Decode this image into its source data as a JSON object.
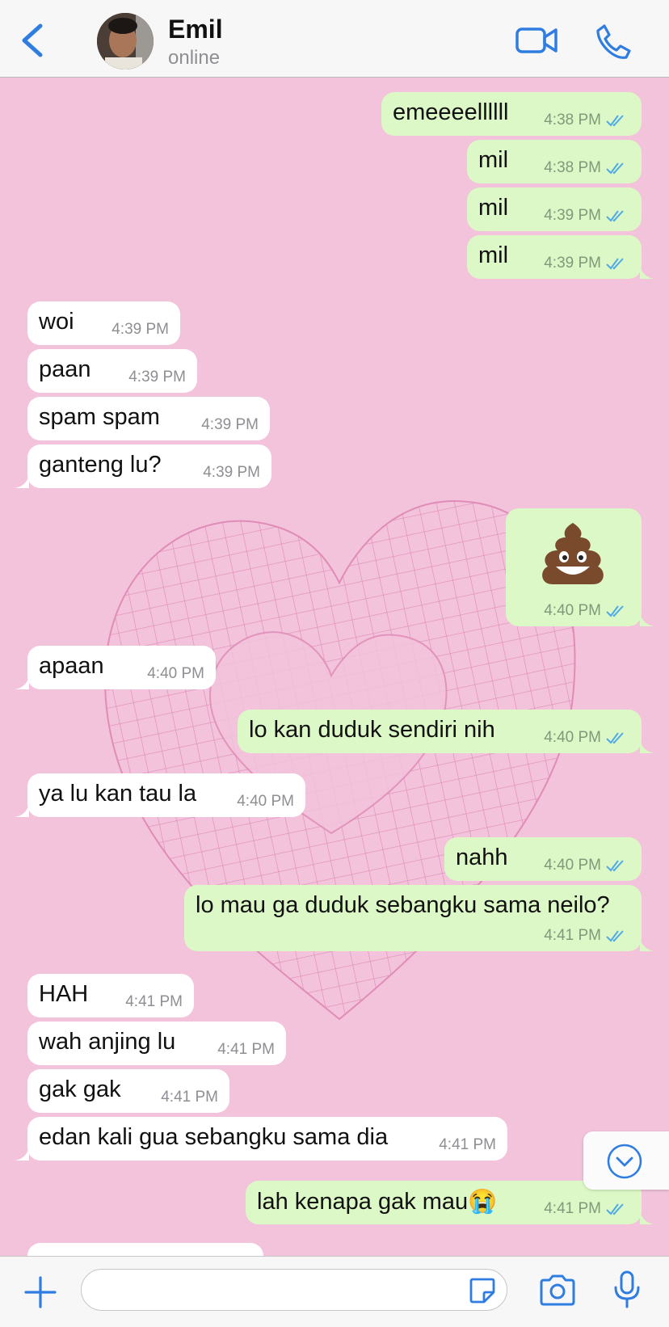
{
  "header": {
    "contact_name": "Emil",
    "status": "online"
  },
  "colors": {
    "accent": "#2f7de1",
    "outgoing_bubble": "#dcf8c6",
    "incoming_bubble": "#ffffff",
    "chat_background": "#f2c3db",
    "read_ticks": "#4fa9e8"
  },
  "messages": [
    {
      "text": "emeeeellllll",
      "time": "4:38 PM",
      "dir": "out",
      "read": true
    },
    {
      "text": "mil",
      "time": "4:38 PM",
      "dir": "out",
      "read": true
    },
    {
      "text": "mil",
      "time": "4:39 PM",
      "dir": "out",
      "read": true
    },
    {
      "text": "mil",
      "time": "4:39 PM",
      "dir": "out",
      "read": true
    },
    {
      "text": "woi",
      "time": "4:39 PM",
      "dir": "in"
    },
    {
      "text": "paan",
      "time": "4:39 PM",
      "dir": "in"
    },
    {
      "text": "spam spam",
      "time": "4:39 PM",
      "dir": "in"
    },
    {
      "text": "ganteng lu?",
      "time": "4:39 PM",
      "dir": "in"
    },
    {
      "text": "",
      "emoji": "poop-emoji",
      "time": "4:40 PM",
      "dir": "out",
      "read": true
    },
    {
      "text": "apaan",
      "time": "4:40 PM",
      "dir": "in"
    },
    {
      "text": "lo kan duduk sendiri nih",
      "time": "4:40 PM",
      "dir": "out",
      "read": true
    },
    {
      "text": "ya lu kan tau la",
      "time": "4:40 PM",
      "dir": "in"
    },
    {
      "text": "nahh",
      "time": "4:40 PM",
      "dir": "out",
      "read": true
    },
    {
      "text": "lo mau ga duduk sebangku sama neilo?",
      "time": "4:41 PM",
      "dir": "out",
      "read": true
    },
    {
      "text": "HAH",
      "time": "4:41 PM",
      "dir": "in"
    },
    {
      "text": "wah anjing lu",
      "time": "4:41 PM",
      "dir": "in"
    },
    {
      "text": "gak gak",
      "time": "4:41 PM",
      "dir": "in"
    },
    {
      "text": "edan kali gua sebangku sama dia",
      "time": "4:41 PM",
      "dir": "in"
    },
    {
      "text": "lah kenapa gak mau😭",
      "time": "4:41 PM",
      "dir": "out",
      "read": true
    }
  ],
  "composer": {
    "placeholder": "",
    "value": ""
  },
  "icons": {
    "back": "chevron-left-icon",
    "video": "video-camera-icon",
    "call": "phone-icon",
    "scroll": "chevron-down-circle-icon",
    "attach": "plus-icon",
    "sticker": "sticker-icon",
    "camera": "camera-icon",
    "mic": "microphone-icon"
  }
}
